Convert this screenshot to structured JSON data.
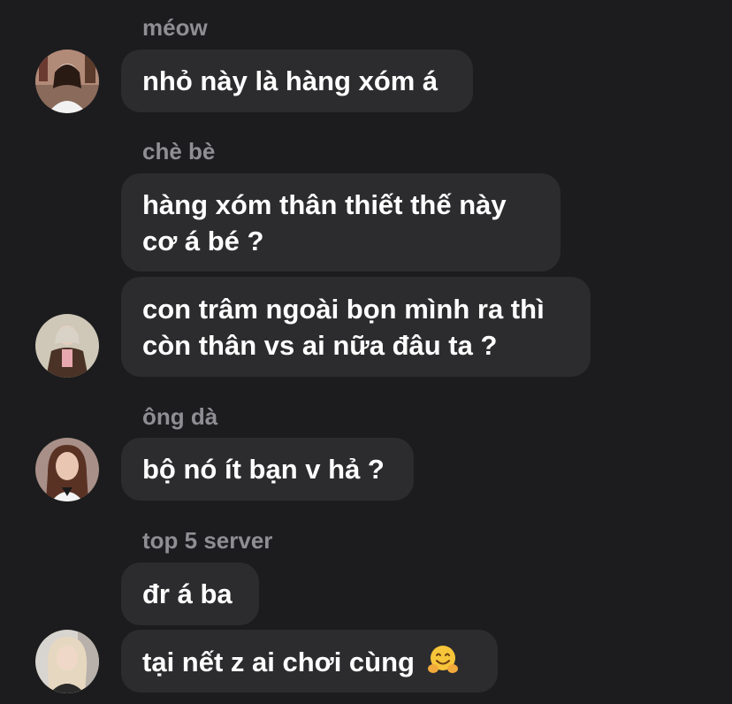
{
  "messages": [
    {
      "sender": "méow",
      "lines": [
        "nhỏ này là hàng xóm á"
      ]
    },
    {
      "sender": "chè bè",
      "lines": [
        "hàng xóm thân thiết thế này",
        "cơ á bé ?"
      ]
    },
    {
      "lines": [
        "con trâm ngoài bọn mình ra thì",
        "còn thân vs ai nữa đâu ta ?"
      ]
    },
    {
      "sender": "ông dà",
      "lines": [
        "bộ nó ít bạn v hả ?"
      ]
    },
    {
      "sender": "top 5 server",
      "lines": [
        "đr á ba"
      ]
    },
    {
      "lines": [
        "tại nết z ai chơi cùng"
      ],
      "emoji": "hugging-face-emoji"
    }
  ],
  "colors": {
    "background": "#1c1c1e",
    "bubble": "#2c2c2e",
    "sender_name": "#8e8e93",
    "text": "#ffffff"
  }
}
